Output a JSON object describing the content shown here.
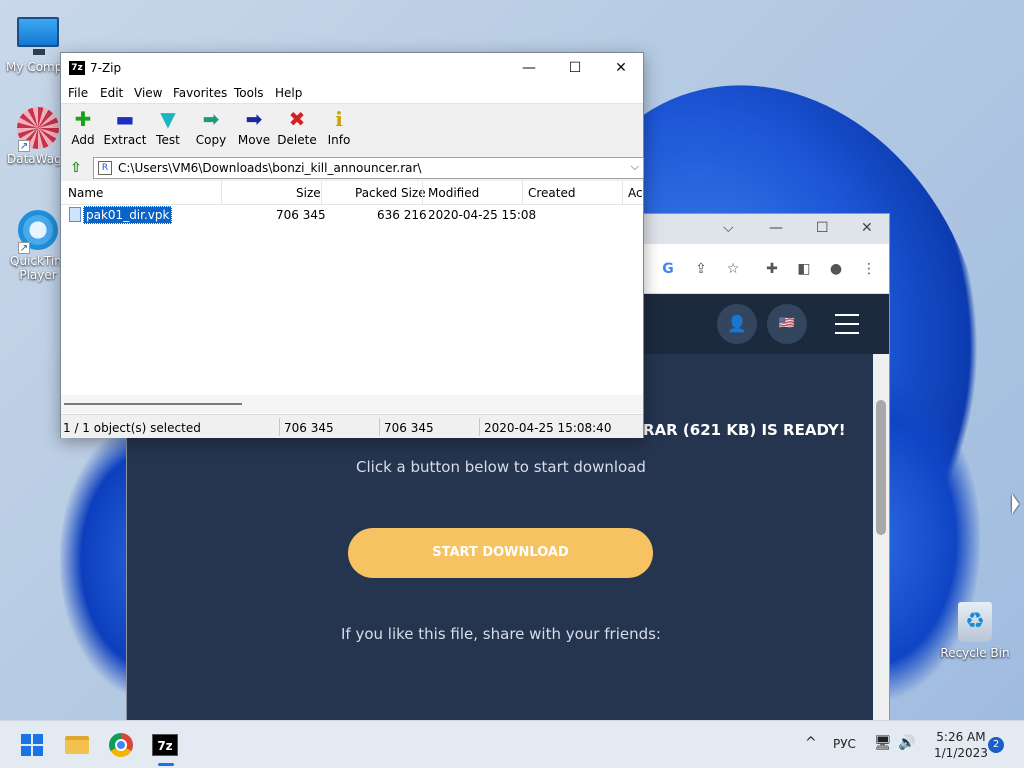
{
  "desktop": {
    "icons": [
      {
        "label": "My Compu",
        "icon": "computer-icon"
      },
      {
        "label": "DataWago",
        "icon": "datawagon-icon"
      },
      {
        "label": "QuickTim Player",
        "icon": "quicktime-icon"
      },
      {
        "label": "Recycle Bin",
        "icon": "recycle-bin-icon"
      }
    ]
  },
  "browser": {
    "dropdown_glyph": "⌵",
    "minimize_glyph": "—",
    "maximize_glyph": "☐",
    "close_glyph": "✕",
    "ready_text": "RAR (621 KB) IS READY!",
    "subtitle": "Click a button below to start download",
    "start_button": "START DOWNLOAD",
    "share_text": "If you like this file, share with your friends:",
    "toolbar_glyphs": {
      "google": "G",
      "share": "⇪",
      "bookmark": "☆",
      "extensions": "✚",
      "sidepanel": "◧",
      "profile": "●",
      "menu": "⋮"
    },
    "nav_glyphs": {
      "user": "👤",
      "flag": "🇺🇸"
    }
  },
  "sevenzip": {
    "title": "7-Zip",
    "logo": "7z",
    "window_buttons": {
      "minimize": "—",
      "maximize": "☐",
      "close": "✕"
    },
    "menu": [
      "File",
      "Edit",
      "View",
      "Favorites",
      "Tools",
      "Help"
    ],
    "toolbar": [
      {
        "label": "Add",
        "glyph": "✚",
        "color": "#1aa31a"
      },
      {
        "label": "Extract",
        "glyph": "▬",
        "color": "#1b2fc4"
      },
      {
        "label": "Test",
        "glyph": "▼",
        "color": "#17b6c2"
      },
      {
        "label": "Copy",
        "glyph": "➡",
        "color": "#1d9a7a"
      },
      {
        "label": "Move",
        "glyph": "➡",
        "color": "#1a2a9e"
      },
      {
        "label": "Delete",
        "glyph": "✖",
        "color": "#d81e1e"
      },
      {
        "label": "Info",
        "glyph": "i",
        "color": "#c9a300"
      }
    ],
    "up_glyph": "⇧",
    "path": "C:\\Users\\VM6\\Downloads\\bonzi_kill_announcer.rar\\",
    "path_icon": "R",
    "path_dropdown": "⌵",
    "columns": [
      "Name",
      "Size",
      "Packed Size",
      "Modified",
      "Created",
      "Ac"
    ],
    "rows": [
      {
        "name": "pak01_dir.vpk",
        "size": "706 345",
        "packed": "636 216",
        "modified": "2020-04-25 15:08",
        "created": ""
      }
    ],
    "status": {
      "selected": "1 / 1 object(s) selected",
      "size": "706 345",
      "packed": "706 345",
      "modified": "2020-04-25 15:08:40"
    }
  },
  "taskbar": {
    "apps": [
      {
        "name": "start",
        "icon": "windows-start-icon"
      },
      {
        "name": "file-explorer",
        "icon": "folder-icon"
      },
      {
        "name": "chrome",
        "icon": "chrome-icon"
      },
      {
        "name": "7-zip",
        "icon": "7zip-icon",
        "label": "7z"
      }
    ],
    "tray": {
      "chevron": "^",
      "language": "РУС",
      "network": "🖥",
      "volume": "🔊"
    },
    "time": "5:26 AM",
    "date": "1/1/2023",
    "notifications": "2"
  },
  "colors": {
    "accent": "#0a64c8",
    "start_button": "#f7c261",
    "site_bg": "#253550"
  }
}
